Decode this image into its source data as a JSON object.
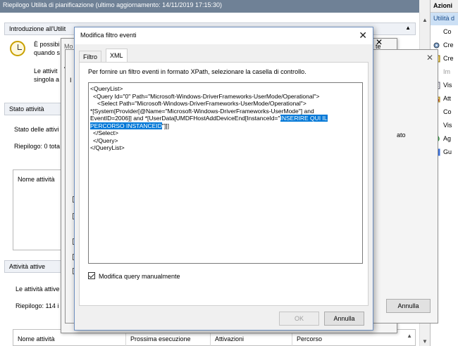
{
  "window_title": "Riepilogo Utilità di pianificazione (ultimo aggiornamento: 14/11/2019 17:15:30)",
  "sections": {
    "intro": {
      "header": "Introduzione all'Utilit",
      "text1": "È possibi",
      "text2": "quando s",
      "text3": "Le attivit",
      "text4": "singola a"
    },
    "status": {
      "header": "Stato attività",
      "line1": "Stato delle attivi",
      "line2": "Riepilogo: 0 tota",
      "box_label": "Nome attività"
    },
    "active": {
      "header": "Attività attive",
      "line1": "Le attività attive",
      "line2": "Riepilogo: 114 i"
    }
  },
  "table": {
    "columns": [
      "Nome attività",
      "Prossima esecuzione",
      "Attivazioni",
      "Percorso"
    ]
  },
  "actions_panel": {
    "header": "Azioni",
    "selected": "Utilità d",
    "items": [
      {
        "label": "Co",
        "icon": "blank-icon",
        "dim": false
      },
      {
        "label": "Cre",
        "icon": "gear-icon",
        "dim": false
      },
      {
        "label": "Cre",
        "icon": "task-icon",
        "dim": false
      },
      {
        "label": "Im",
        "icon": "blank-icon",
        "dim": true
      },
      {
        "label": "Vis",
        "icon": "list-icon",
        "dim": false
      },
      {
        "label": "Att",
        "icon": "folder-icon",
        "dim": false
      },
      {
        "label": "Co",
        "icon": "blank-icon",
        "dim": false
      },
      {
        "label": "Vis",
        "icon": "blank-icon",
        "dim": false
      },
      {
        "label": "Ag",
        "icon": "refresh-icon",
        "dim": false
      },
      {
        "label": "Gu",
        "icon": "help-icon",
        "dim": false
      }
    ]
  },
  "behind_dialogs": {
    "title_fragment_mo": "Mo",
    "title_fragment_te": "te",
    "label_av": "Av",
    "label_i": "I",
    "label_ato": "ato",
    "cancel_label": "Annulla"
  },
  "dialog": {
    "title": "Modifica filtro eventi",
    "tabs": [
      "Filtro",
      "XML"
    ],
    "active_tab": "XML",
    "hint": "Per fornire un filtro eventi in formato XPath, selezionare la casella di controllo.",
    "xml_lines": [
      "<QueryList>",
      "  <Query Id=\"0\" Path=\"Microsoft-Windows-DriverFrameworks-UserMode/Operational\">",
      "    <Select Path=\"Microsoft-Windows-DriverFrameworks-UserMode/Operational\">",
      "*[System[Provider[@Name=\"Microsoft-Windows-DriverFrameworks-UserMode\"] and",
      "EventID=2006]] and *[UserData[UMDFHostAddDeviceEnd[InstanceId=\""
    ],
    "xml_selected_part1": "INSERIRE QUI IL",
    "xml_selected_part2": "PERCORSO INSTANCEID",
    "xml_after_selection": "\"]]]",
    "xml_tail": [
      "  </Select>",
      "  </Query>",
      "</QueryList>"
    ],
    "manual_checkbox_label": "Modifica query manualmente",
    "manual_checked": true,
    "ok_label": "OK",
    "cancel_label": "Annulla"
  }
}
